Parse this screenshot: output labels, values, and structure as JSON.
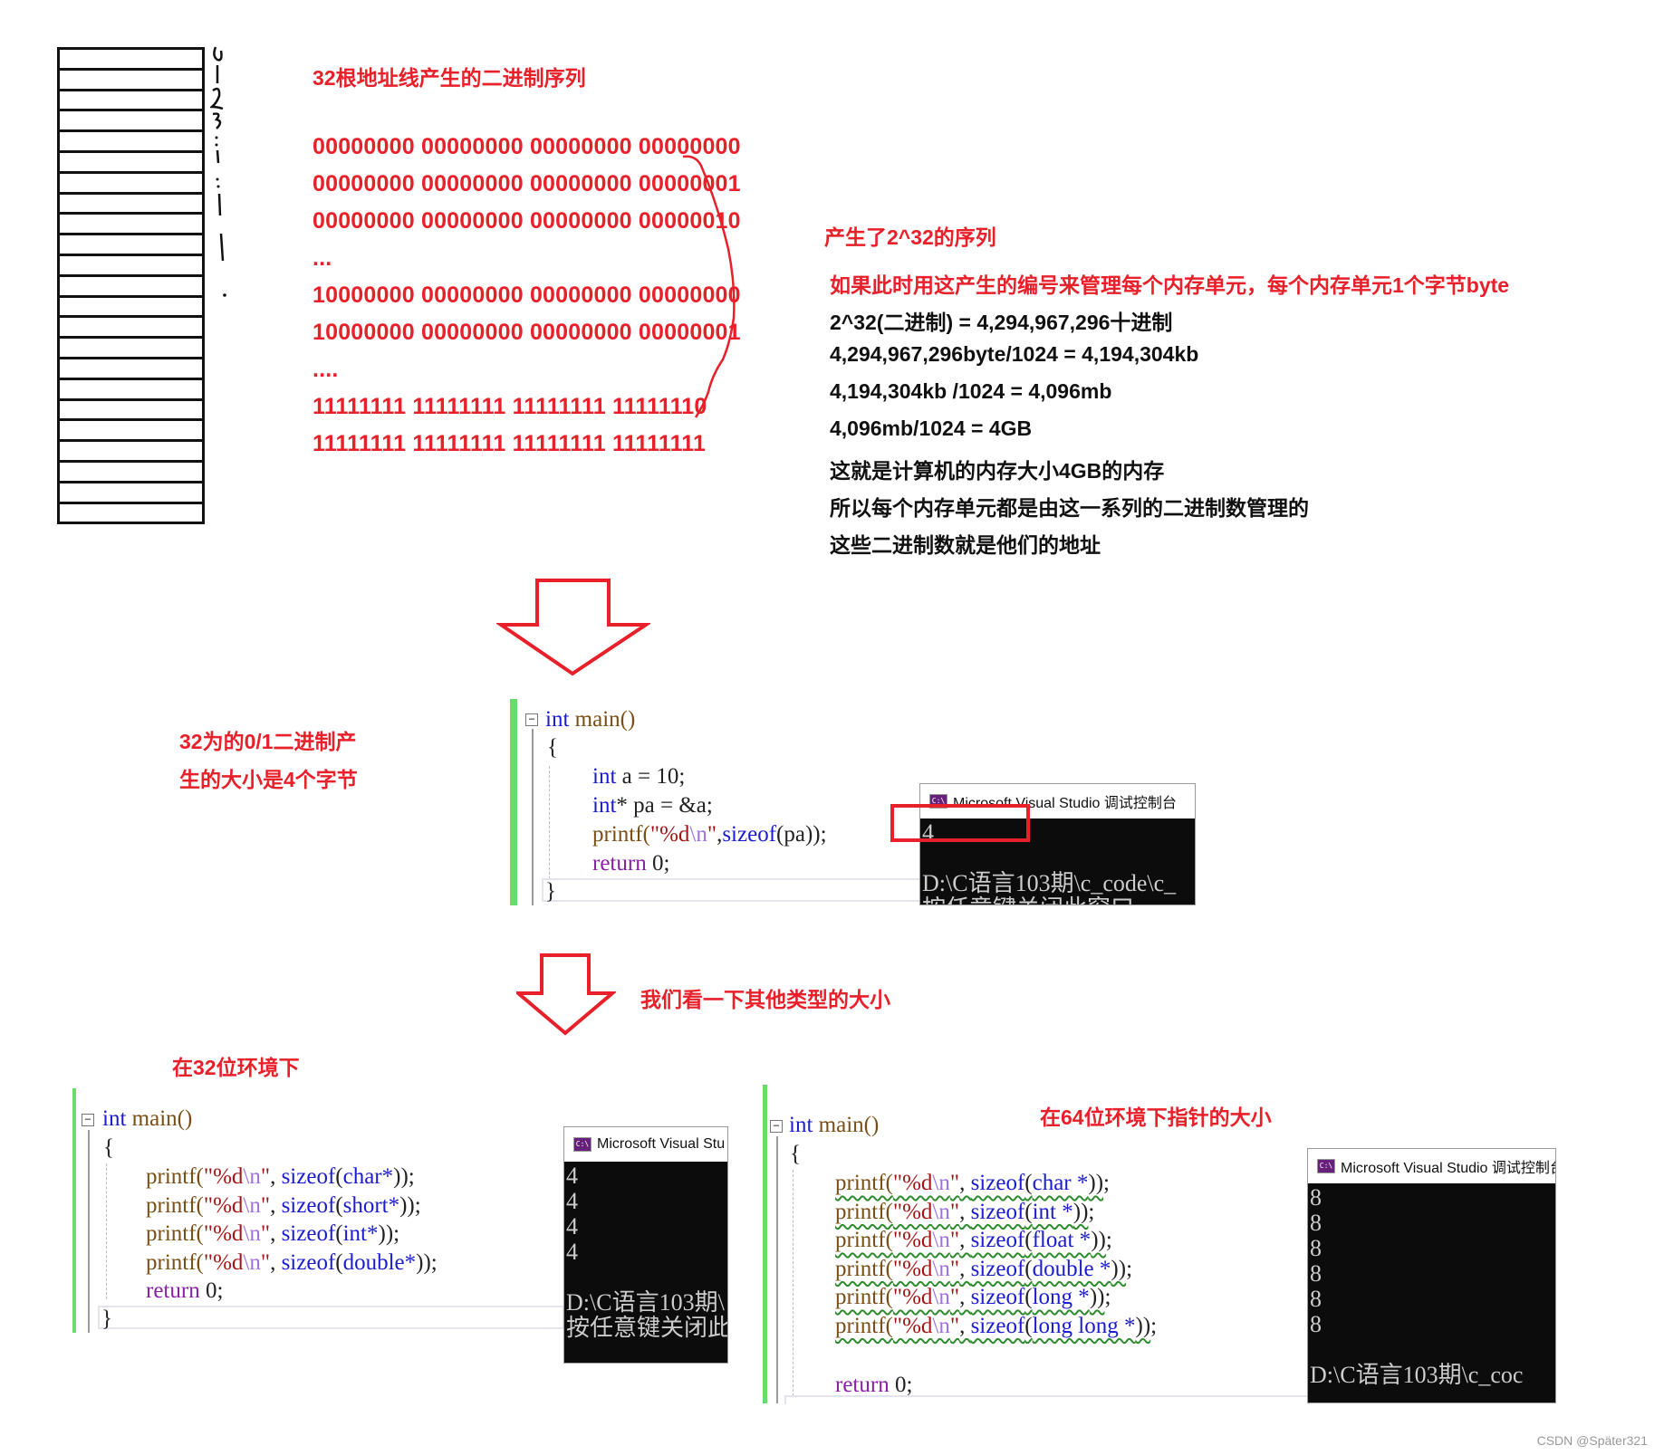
{
  "section1": {
    "title": "32根地址线产生的二进制序列",
    "grid_rows": 23,
    "address_labels": [
      "0",
      "1",
      "2",
      "3",
      ":",
      "⋮"
    ],
    "binary_lines": [
      "00000000 00000000 00000000 00000000",
      "00000000 00000000 00000000 00000001",
      "00000000 00000000 00000000 00000010",
      "...",
      "10000000 00000000 00000000 00000000",
      "10000000 00000000 00000000 00000001",
      "....",
      "11111111 11111111 11111111 11111110",
      "11111111 11111111 11111111 11111111"
    ],
    "brace_label": "产生了2^32的序列",
    "explain_red": "如果此时用这产生的编号来管理每个内存单元，每个内存单元1个字节byte",
    "explain_lines": [
      "2^32(二进制) = 4,294,967,296十进制",
      "4,294,967,296byte/1024 = 4,194,304kb",
      "4,194,304kb /1024 = 4,096mb",
      "4,096mb/1024 = 4GB",
      "这就是计算机的内存大小4GB的内存",
      "所以每个内存单元都是由这一系列的二进制数管理的",
      "这些二进制数就是他们的地址"
    ]
  },
  "section2": {
    "note_lines": [
      "32为的0/1二进制产",
      "生的大小是4个字节"
    ],
    "code": {
      "l1_kw": "int",
      "l1_fn": " main()",
      "l2": "{",
      "l3_kw": "int",
      "l3_rest": " a = 10;",
      "l4_kw": "int",
      "l4_rest": "* pa = &a;",
      "l5_fn": "printf(",
      "l5_str1": "\"%d",
      "l5_esc": "\\n",
      "l5_str2": "\"",
      "l5_comma": ",",
      "l5_kw": "sizeof",
      "l5_rest": "(pa));",
      "l6_kw": "return",
      "l6_rest": " 0;",
      "l7": "}"
    },
    "console": {
      "title": "Microsoft Visual Studio 调试控制台",
      "icon": "vs-console-icon",
      "output": [
        "4",
        "",
        "D:\\C语言103期\\c_code\\c_",
        "按任意键关闭此窗口"
      ]
    },
    "highlight_color": "#e8202a"
  },
  "section3": {
    "heading": "我们看一下其他类型的大小",
    "left_label": "在32位环境下",
    "left_code": {
      "header_kw": "int",
      "header_fn": " main()",
      "open": "{",
      "lines": [
        {
          "type": "char*"
        },
        {
          "type": "short*"
        },
        {
          "type": "int*"
        },
        {
          "type": "double*"
        }
      ],
      "printf": "printf(",
      "fmt_a": "\"%d",
      "fmt_esc": "\\n",
      "fmt_b": "\"",
      "sep": ", ",
      "sizeof": "sizeof",
      "close": "));",
      "return_kw": "return",
      "return_rest": " 0;",
      "close_brace": "}"
    },
    "left_console": {
      "title": "Microsoft Visual Stu",
      "output": [
        "4",
        "4",
        "4",
        "4",
        "",
        "D:\\C语言103期\\",
        "按任意键关闭此"
      ]
    },
    "right_label": "在64位环境下指针的大小",
    "right_code": {
      "header_kw": "int",
      "header_fn": " main()",
      "open": "{",
      "lines": [
        {
          "type": "char *"
        },
        {
          "type": "int *"
        },
        {
          "type": "float *"
        },
        {
          "type": "double *"
        },
        {
          "type": "long *"
        },
        {
          "type": "long long *"
        }
      ],
      "return_kw": "return",
      "return_rest": " 0;"
    },
    "right_console": {
      "title": "Microsoft Visual Studio 调试控制台",
      "output": [
        "8",
        "8",
        "8",
        "8",
        "8",
        "8",
        "",
        "D:\\C语言103期\\c_coc"
      ]
    }
  },
  "watermark": "CSDN @Später321",
  "colors": {
    "annotation_red": "#e8202a",
    "editor_bar_green": "#6bdc6b",
    "keyword_blue": "#1c1ccf",
    "console_bg": "#0c0c0c"
  }
}
